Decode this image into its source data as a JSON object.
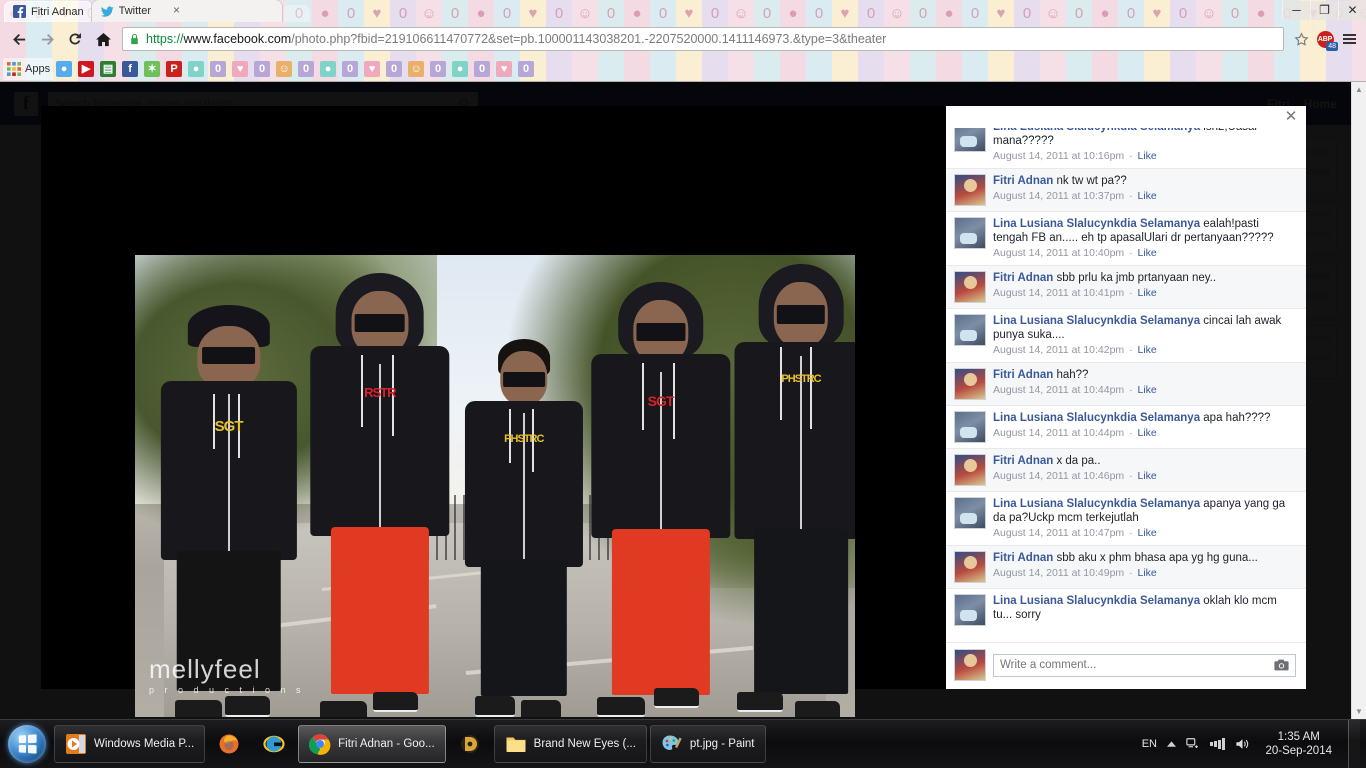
{
  "browser": {
    "tabs": [
      {
        "title": "Fitri Adnan",
        "favicon": "facebook-icon",
        "active": false
      },
      {
        "title": "Twitter",
        "favicon": "twitter-icon",
        "active": true
      }
    ],
    "tab_close_label": "×",
    "nav": {
      "back_icon": "back-arrow-icon",
      "forward_icon": "forward-arrow-icon",
      "reload_icon": "reload-icon",
      "home_icon": "home-icon"
    },
    "omnibox": {
      "scheme": "https://",
      "host": "www.facebook.com",
      "path": "/photo.php?fbid=219106611470772&set=pb.100001143038201.-2207520000.1411146973.&type=3&theater",
      "full_url": "https://www.facebook.com/photo.php?fbid=219106611470772&set=pb.100001143038201.-2207520000.1411146973.&type=3&theater",
      "lock_icon": "lock-icon",
      "star_icon": "star-icon"
    },
    "extensions": {
      "adblock_label": "ABP",
      "adblock_badge": "48",
      "menu_icon": "hamburger-menu-icon"
    },
    "window_controls": {
      "minimize": "─",
      "maximize": "❐",
      "close": "✕"
    },
    "bookmarks_bar": {
      "apps_label": "Apps",
      "apps_icon": "apps-grid-icon",
      "items": [
        "twitter-icon",
        "youtube-icon",
        "notes-icon",
        "facebook-icon",
        "android-icon",
        "pinterest-icon",
        "bird-icon",
        "zero-icon",
        "heart-icon",
        "zero-icon",
        "person-icon",
        "zero-icon",
        "bird-icon",
        "zero-icon",
        "heart-icon",
        "zero-icon",
        "person-icon",
        "zero-icon",
        "bird-icon",
        "zero-icon",
        "heart-icon",
        "zero-icon"
      ]
    }
  },
  "facebook_page": {
    "search_placeholder": "Search for people, places and things",
    "search_icon": "magnifier-icon",
    "logo_letter": "f",
    "nav_items": [
      "Fitri",
      "Home"
    ]
  },
  "theater": {
    "close_label": "✕",
    "photo": {
      "description": "Five young men in black hoodies and sunglasses walking along a paved path with trees behind",
      "watermark_line1": "mellyfeel",
      "watermark_line2": "p r o d u c t i o n s",
      "figure_logos": [
        "SGT",
        "RSTR",
        "PHSTRC",
        "SGT",
        "PHSTRC"
      ],
      "figure_logo_colors": [
        "#e8c22a",
        "#d7232a",
        "#e8c22a",
        "#d7232a",
        "#e8c22a"
      ]
    },
    "comments": [
      {
        "author": "Lina Lusiana Slalucynkdia Selamanya",
        "text": "ish2,Uasal mana?????",
        "timestamp": "August 14, 2011 at 10:16pm",
        "like_label": "Like",
        "avatar": "lina-avatar",
        "clipped_top": true
      },
      {
        "author": "Fitri Adnan",
        "text": "nk tw wt pa??",
        "timestamp": "August 14, 2011 at 10:37pm",
        "like_label": "Like",
        "avatar": "fitri-avatar"
      },
      {
        "author": "Lina Lusiana Slalucynkdia Selamanya",
        "text": "ealah!pasti tengah FB an..... eh tp apasalUlari dr pertanyaan?????",
        "timestamp": "August 14, 2011 at 10:40pm",
        "like_label": "Like",
        "avatar": "lina-avatar"
      },
      {
        "author": "Fitri Adnan",
        "text": "sbb prlu ka jmb prtanyaan ney..",
        "timestamp": "August 14, 2011 at 10:41pm",
        "like_label": "Like",
        "avatar": "fitri-avatar"
      },
      {
        "author": "Lina Lusiana Slalucynkdia Selamanya",
        "text": "cincai lah awak punya suka....",
        "timestamp": "August 14, 2011 at 10:42pm",
        "like_label": "Like",
        "avatar": "lina-avatar"
      },
      {
        "author": "Fitri Adnan",
        "text": "hah??",
        "timestamp": "August 14, 2011 at 10:44pm",
        "like_label": "Like",
        "avatar": "fitri-avatar"
      },
      {
        "author": "Lina Lusiana Slalucynkdia Selamanya",
        "text": "apa hah????",
        "timestamp": "August 14, 2011 at 10:44pm",
        "like_label": "Like",
        "avatar": "lina-avatar"
      },
      {
        "author": "Fitri Adnan",
        "text": "x da pa..",
        "timestamp": "August 14, 2011 at 10:46pm",
        "like_label": "Like",
        "avatar": "fitri-avatar"
      },
      {
        "author": "Lina Lusiana Slalucynkdia Selamanya",
        "text": "apanya yang ga da pa?Uckp mcm terkejutlah",
        "timestamp": "August 14, 2011 at 10:47pm",
        "like_label": "Like",
        "avatar": "lina-avatar"
      },
      {
        "author": "Fitri Adnan",
        "text": "sbb aku x phm bhasa apa yg hg guna...",
        "timestamp": "August 14, 2011 at 10:49pm",
        "like_label": "Like",
        "avatar": "fitri-avatar"
      },
      {
        "author": "Lina Lusiana Slalucynkdia Selamanya",
        "text": "oklah klo mcm tu... sorry",
        "timestamp": "",
        "like_label": "",
        "avatar": "lina-avatar",
        "clipped_bottom": true
      }
    ],
    "compose": {
      "placeholder": "Write a comment...",
      "value": "",
      "camera_icon": "camera-icon",
      "avatar": "fitri-avatar"
    }
  },
  "scrollbar": {
    "up_arrow": "▲",
    "down_arrow": "▼"
  },
  "taskbar": {
    "start_label": "start-orb",
    "items": [
      {
        "label": "Windows Media P...",
        "icon": "windows-media-player-icon",
        "active": false,
        "icon_only": false
      },
      {
        "label": "",
        "icon": "firefox-icon",
        "active": false,
        "icon_only": true
      },
      {
        "label": "",
        "icon": "internet-explorer-icon",
        "active": false,
        "icon_only": true
      },
      {
        "label": "Fitri Adnan - Goo...",
        "icon": "chrome-icon",
        "active": true,
        "icon_only": false
      },
      {
        "label": "",
        "icon": "daemon-tools-icon",
        "active": false,
        "icon_only": true
      },
      {
        "label": "Brand New Eyes (...",
        "icon": "folder-icon",
        "active": false,
        "icon_only": false
      },
      {
        "label": "pt.jpg - Paint",
        "icon": "paint-icon",
        "active": false,
        "icon_only": false
      }
    ],
    "tray": {
      "language": "EN",
      "show_hidden_icon": "chevron-up-icon",
      "network_icon": "network-icon",
      "signal_icon": "signal-bars-icon",
      "volume_icon": "volume-icon",
      "time": "1:35 AM",
      "date": "20-Sep-2014"
    }
  },
  "colors": {
    "facebook_blue": "#3b5998",
    "chrome_toolbar": "#e8e3e8",
    "taskbar": "#0c0c0e",
    "adblock_red": "#c9211e",
    "link_blue": "#3b5998"
  }
}
